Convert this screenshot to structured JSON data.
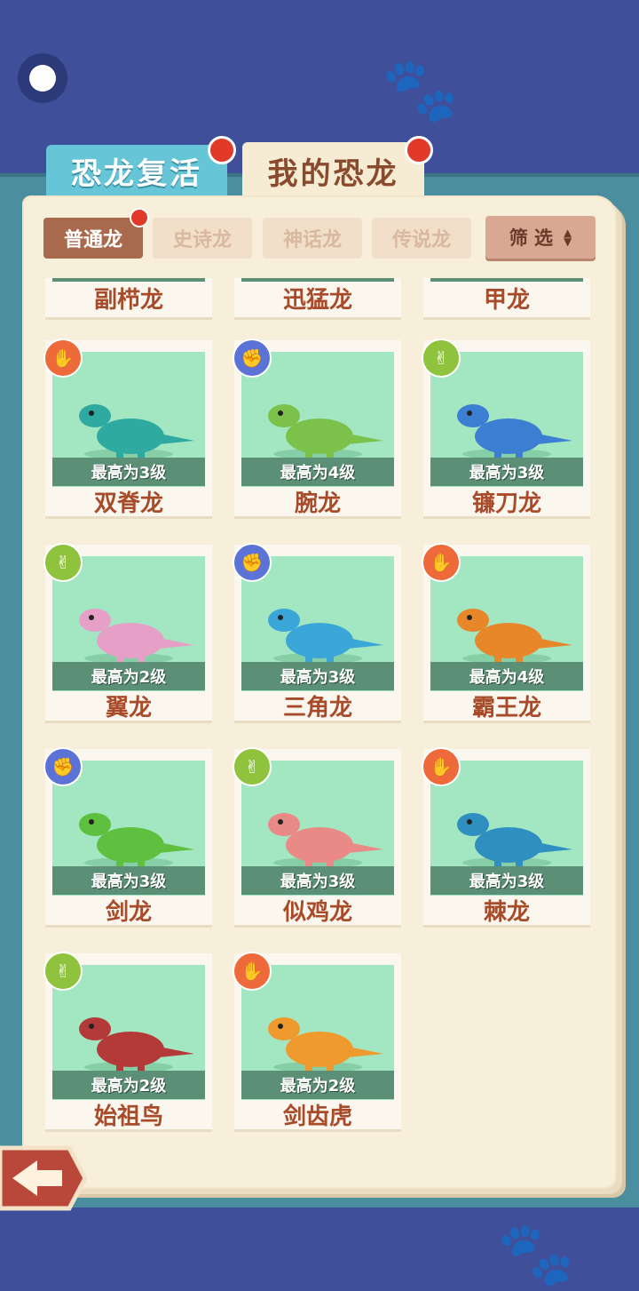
{
  "tabs": [
    {
      "label": "恐龙复活",
      "has_dot": true
    },
    {
      "label": "我的恐龙",
      "has_dot": true
    }
  ],
  "subtabs": [
    "普通龙",
    "史诗龙",
    "神话龙",
    "传说龙"
  ],
  "filter_label": "筛 选",
  "top_partial_row": [
    "副栉龙",
    "迅猛龙",
    "甲龙"
  ],
  "cards": [
    {
      "name": "双脊龙",
      "level": "最高为3级",
      "badge": "paper",
      "color": "#2eaaa0"
    },
    {
      "name": "腕龙",
      "level": "最高为4级",
      "badge": "rock",
      "color": "#7cc24a"
    },
    {
      "name": "镰刀龙",
      "level": "最高为3级",
      "badge": "scissors",
      "color": "#3c7ed2"
    },
    {
      "name": "翼龙",
      "level": "最高为2级",
      "badge": "scissors",
      "color": "#e6a0c8"
    },
    {
      "name": "三角龙",
      "level": "最高为3级",
      "badge": "rock",
      "color": "#3aa7d8"
    },
    {
      "name": "霸王龙",
      "level": "最高为4级",
      "badge": "paper",
      "color": "#e8862a"
    },
    {
      "name": "剑龙",
      "level": "最高为3级",
      "badge": "rock",
      "color": "#5fbf3e"
    },
    {
      "name": "似鸡龙",
      "level": "最高为3级",
      "badge": "scissors",
      "color": "#e98a86"
    },
    {
      "name": "棘龙",
      "level": "最高为3级",
      "badge": "paper",
      "color": "#2f8fc0"
    },
    {
      "name": "始祖鸟",
      "level": "最高为2级",
      "badge": "scissors",
      "color": "#b43a3a"
    },
    {
      "name": "剑齿虎",
      "level": "最高为2级",
      "badge": "paper",
      "color": "#ef9a2e"
    }
  ],
  "badge_icons": {
    "rock": "✊",
    "paper": "✋",
    "scissors": "✌"
  },
  "colors": {
    "accent": "#a9694c",
    "name_text": "#a84b2b",
    "card_bg": "#a3e6c2",
    "level_bar": "#5b8f76"
  }
}
